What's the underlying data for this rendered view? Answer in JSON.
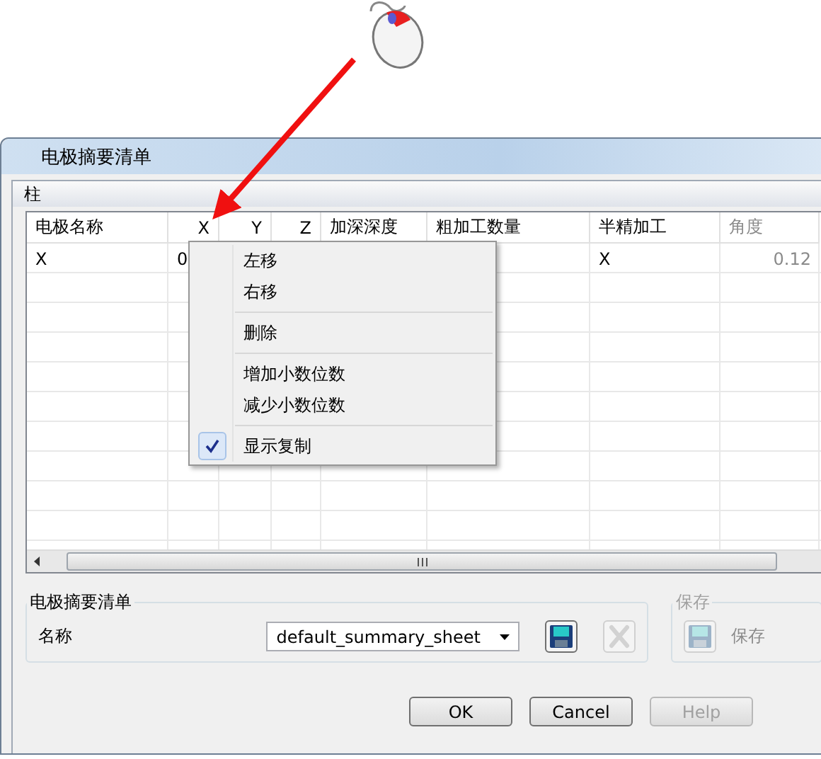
{
  "dialog": {
    "title": "电极摘要清单",
    "columns_group": {
      "title": "柱"
    },
    "table": {
      "columns": [
        {
          "label": "电极名称",
          "disabled": false
        },
        {
          "label": "X",
          "disabled": false
        },
        {
          "label": "Y",
          "disabled": false
        },
        {
          "label": "Z",
          "disabled": false
        },
        {
          "label": "加深深度",
          "disabled": false
        },
        {
          "label": "粗加工数量",
          "disabled": false
        },
        {
          "label": "半精加工",
          "disabled": false
        },
        {
          "label": "角度",
          "disabled": true
        }
      ],
      "rows": [
        {
          "cells": [
            {
              "text": "X"
            },
            {
              "text": "0"
            },
            {},
            {},
            {},
            {},
            {
              "text": "X"
            },
            {
              "text": "0.12"
            }
          ]
        }
      ]
    },
    "context_menu": {
      "sections": [
        [
          {
            "label": "左移",
            "checked": false
          },
          {
            "label": "右移",
            "checked": false
          }
        ],
        [
          {
            "label": "删除",
            "checked": false
          }
        ],
        [
          {
            "label": "增加小数位数",
            "checked": false
          },
          {
            "label": "减少小数位数",
            "checked": false
          }
        ],
        [
          {
            "label": "显示复制",
            "checked": true
          }
        ]
      ]
    },
    "sheet_group": {
      "title": "电极摘要清单",
      "name_label": "名称",
      "name_value": "default_summary_sheet",
      "save_disabled": false,
      "delete_disabled": true
    },
    "save_group": {
      "title": "保存",
      "disabled": true,
      "button_label": "保存"
    },
    "buttons": [
      {
        "label": "OK",
        "disabled": false
      },
      {
        "label": "Cancel",
        "disabled": false
      },
      {
        "label": "Help",
        "disabled": true
      }
    ]
  }
}
